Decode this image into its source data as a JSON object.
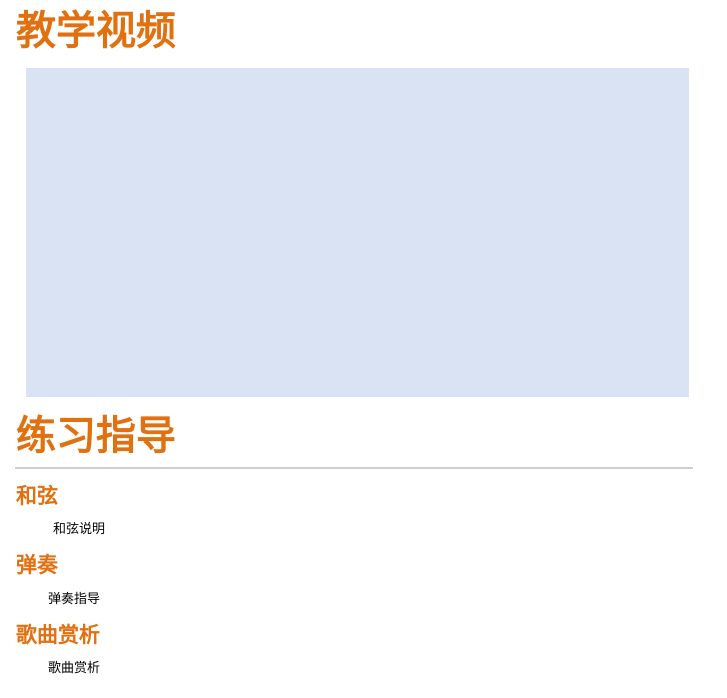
{
  "header": {
    "title": "教学视频"
  },
  "video": {},
  "practice": {
    "title": "练习指导",
    "sections": [
      {
        "heading": "和弦",
        "text": "和弦说明"
      },
      {
        "heading": "弹奏",
        "text": "弹奏指导"
      },
      {
        "heading": "歌曲赏析",
        "text": "歌曲赏析"
      }
    ]
  },
  "colors": {
    "accent": "#e07010",
    "video_placeholder": "#dae3f4",
    "divider": "#cfcfcf"
  }
}
